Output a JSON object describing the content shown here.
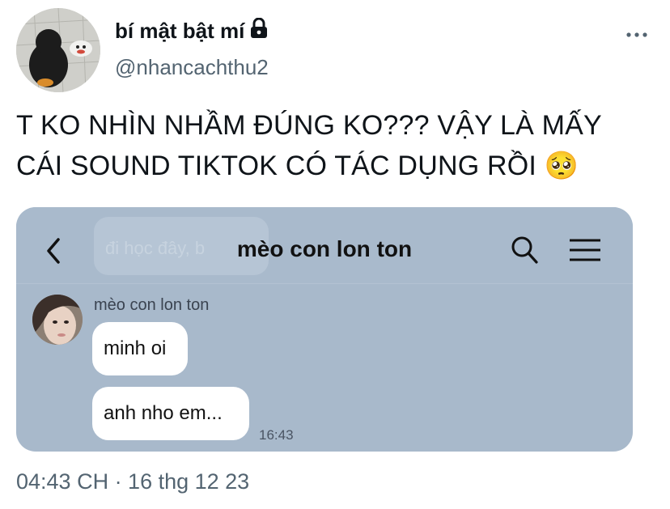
{
  "tweet": {
    "display_name": "bí mật bật mí",
    "handle": "@nhancachthu2",
    "text_line1": "T KO NHÌN NHẦM ĐÚNG KO??? VẬY LÀ MẤY",
    "text_line2": "CÁI SOUND TIKTOK CÓ TÁC DỤNG RỒI",
    "emoji": "🥺",
    "timestamp": "04:43 CH · 16 thg 12 23",
    "icons": {
      "lock": "lock-icon",
      "more": "more-horizontal-icon"
    }
  },
  "chat": {
    "title": "mèo con lon ton",
    "ghost_preview": "đi học đây, b",
    "sender_name": "mèo con lon ton",
    "messages": [
      {
        "text": "minh oi"
      },
      {
        "text": "anh nho em..."
      }
    ],
    "message_time": "16:43",
    "icons": {
      "back": "back-arrow-icon",
      "search": "search-icon",
      "menu": "menu-icon"
    },
    "colors": {
      "background": "#a8b9cb",
      "bubble": "#ffffff"
    }
  }
}
